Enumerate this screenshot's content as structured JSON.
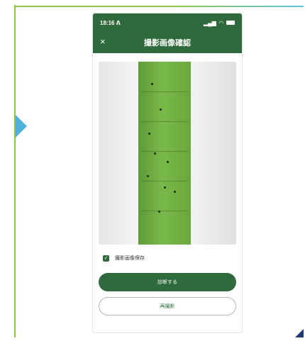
{
  "status": {
    "time": "18:16 ᕕ",
    "signal": "▂▄▆",
    "wifi": "wifi"
  },
  "nav": {
    "close_label": "×",
    "title": "撮影画像確認"
  },
  "image": {
    "subject": "leaf-on-white-background"
  },
  "options": {
    "checkbox_label": "撮影画像保存",
    "checked": true
  },
  "actions": {
    "primary_label": "診断する",
    "secondary_label": "再撮影"
  },
  "colors": {
    "brand": "#2e6a3b",
    "accent_left": "#8cc63f",
    "accent_right": "#5bc0de",
    "arrow": "#4fb3d9",
    "corner": "#1f3a6b"
  }
}
